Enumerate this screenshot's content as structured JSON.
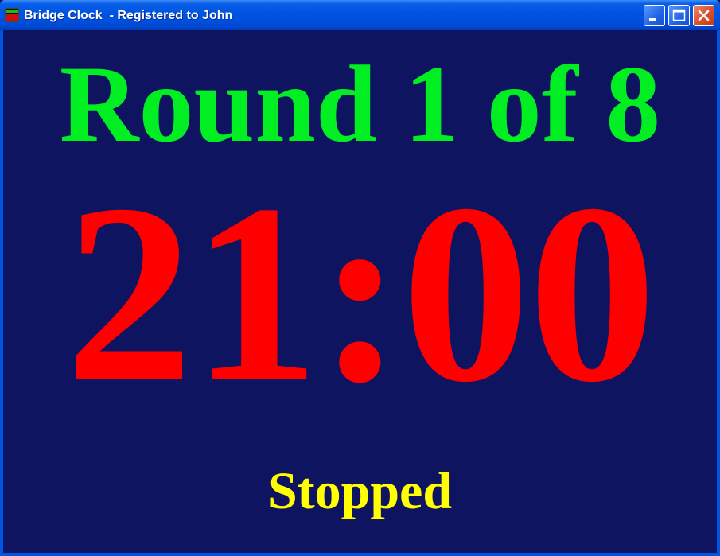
{
  "window": {
    "title": "Bridge Clock  - Registered to John",
    "controls": {
      "minimize_icon": "minimize-icon",
      "maximize_icon": "maximize-icon",
      "close_icon": "close-icon"
    }
  },
  "display": {
    "round_text": "Round 1 of 8",
    "time_remaining": "21:00",
    "status": "Stopped"
  },
  "colors": {
    "background": "#0f1460",
    "round_text": "#00ee22",
    "time_text": "#ff0000",
    "status_text": "#ffff00"
  }
}
